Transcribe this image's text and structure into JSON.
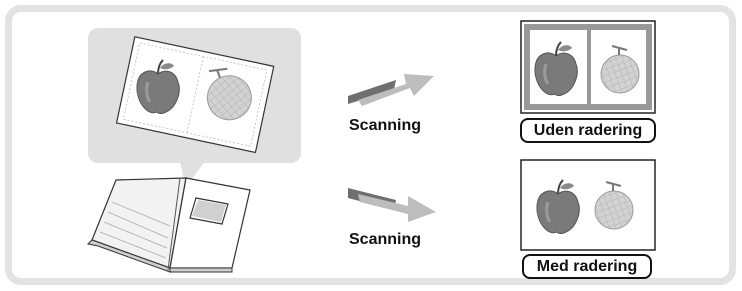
{
  "diagram": {
    "scan_label_top": "Scanning",
    "scan_label_bottom": "Scanning",
    "result_top_label": "Uden radering",
    "result_bottom_label": "Med radering"
  },
  "colors": {
    "frame": "#e3e3e3",
    "bubble": "#e0e0e0",
    "apple": "#7a7a7a",
    "melon": "#c8c8c8",
    "arrow_dark": "#6f6f6f",
    "arrow_light": "#bdbdbd",
    "text": "#111111"
  },
  "icons": [
    "book-icon",
    "speech-bubble-icon",
    "scan-arrow-icon",
    "apple-icon",
    "melon-icon"
  ]
}
